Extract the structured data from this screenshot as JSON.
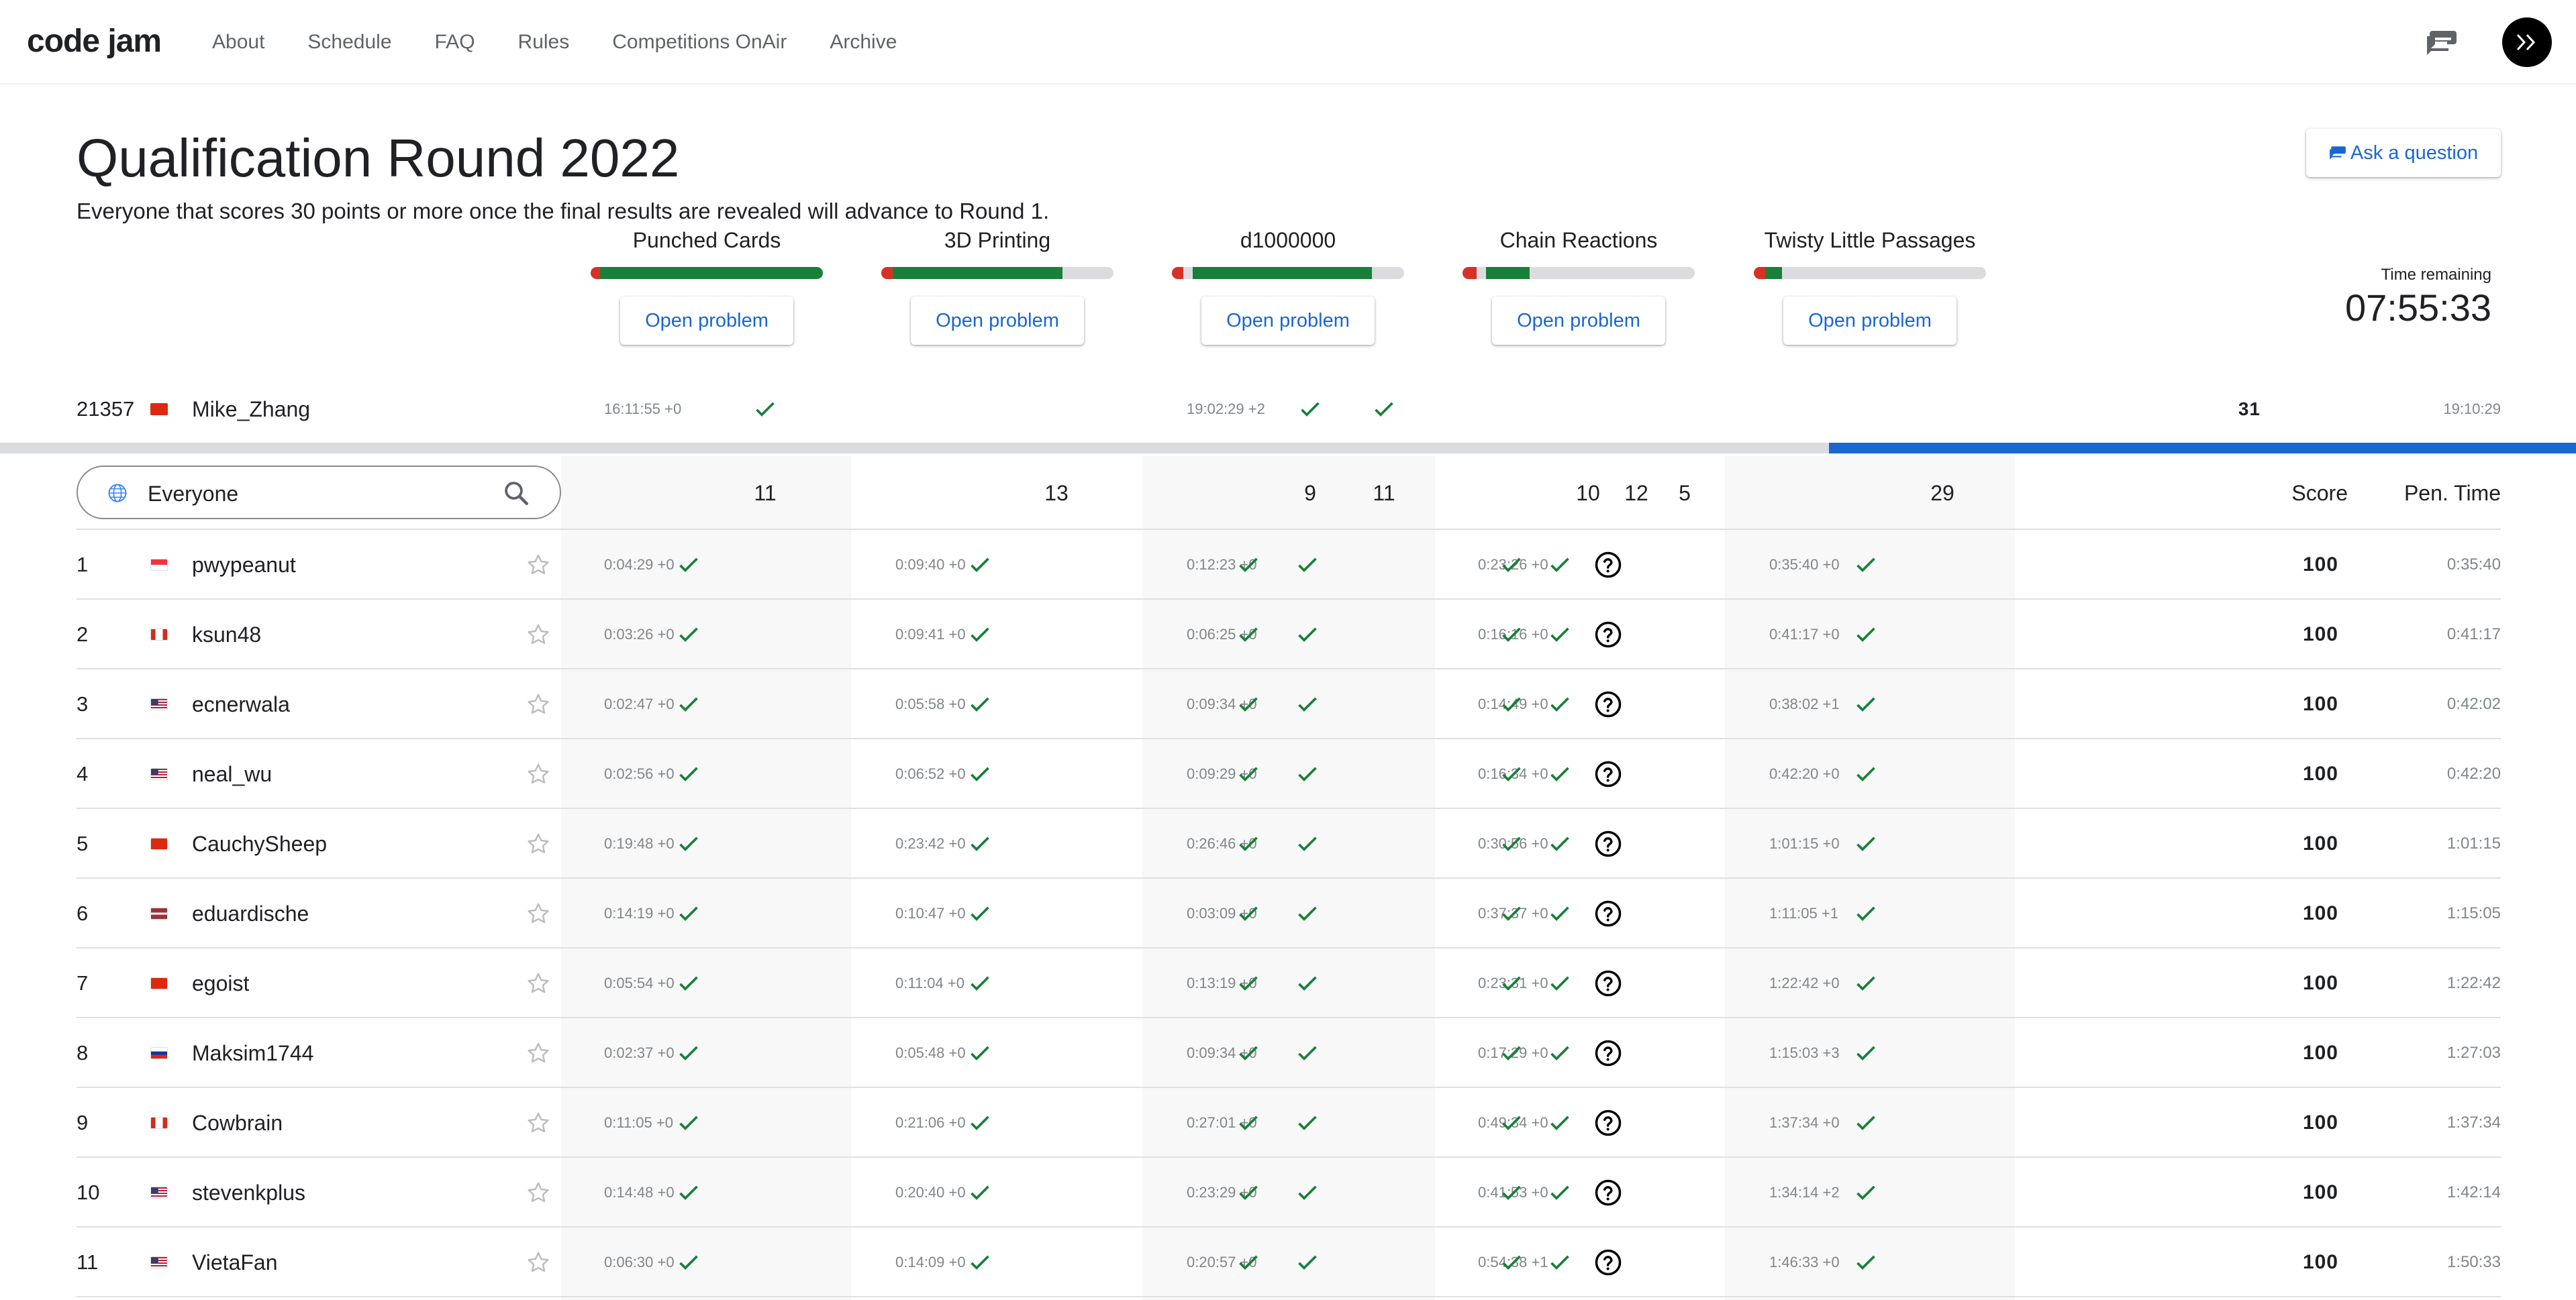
{
  "nav": {
    "brand": "code jam",
    "links": [
      "About",
      "Schedule",
      "FAQ",
      "Rules",
      "Competitions OnAir",
      "Archive"
    ]
  },
  "header": {
    "title": "Qualification Round 2022",
    "subtitle": "Everyone that scores 30 points or more once the final results are revealed will advance to Round 1.",
    "ask_label": "Ask a question",
    "time_label": "Time remaining",
    "time_value": "07:55:33"
  },
  "problems": [
    {
      "name": "Punched Cards",
      "button": "Open problem",
      "red_fraction": 0.04,
      "green_fraction": 1.0
    },
    {
      "name": "3D Printing",
      "button": "Open problem",
      "red_fraction": 0.05,
      "green_fraction": 0.78
    },
    {
      "name": "d1000000",
      "button": "Open problem",
      "red_fraction": 0.05,
      "green_fraction": 0.86,
      "gap_fraction": 0.04
    },
    {
      "name": "Chain Reactions",
      "button": "Open problem",
      "red_fraction": 0.06,
      "green_fraction": 0.29,
      "gap_fraction": 0.04
    },
    {
      "name": "Twisty Little Passages",
      "button": "Open problem",
      "red_fraction": 0.05,
      "green_fraction": 0.12
    }
  ],
  "me": {
    "rank": "21357",
    "name": "Mike_Zhang",
    "p1_time": "16:11:55 +0",
    "p3_time": "19:02:29 +2",
    "score": "31",
    "penalty": "19:10:29",
    "progress_fraction": 0.29
  },
  "filter": {
    "value": "Everyone",
    "col_points": [
      "11",
      "13",
      "9",
      "11",
      "10",
      "12",
      "5",
      "29"
    ],
    "score_label": "Score",
    "penalty_label": "Pen. Time"
  },
  "colors": {
    "accent": "#1967d2",
    "green": "#188038",
    "red": "#d93025",
    "band": "#f8f8f8"
  },
  "rows": [
    {
      "rank": "1",
      "flag": "singapore",
      "name": "pwypeanut",
      "t1": "0:04:29 +0",
      "t2": "0:09:40 +0",
      "t3": "0:12:23 +0",
      "t4": "0:23:26 +0",
      "t5": "0:35:40 +0",
      "score": "100",
      "pen": "0:35:40"
    },
    {
      "rank": "2",
      "flag": "canada",
      "name": "ksun48",
      "t1": "0:03:26 +0",
      "t2": "0:09:41 +0",
      "t3": "0:06:25 +0",
      "t4": "0:16:16 +0",
      "t5": "0:41:17 +0",
      "score": "100",
      "pen": "0:41:17"
    },
    {
      "rank": "3",
      "flag": "usa",
      "name": "ecnerwala",
      "t1": "0:02:47 +0",
      "t2": "0:05:58 +0",
      "t3": "0:09:34 +0",
      "t4": "0:14:49 +0",
      "t5": "0:38:02 +1",
      "score": "100",
      "pen": "0:42:02"
    },
    {
      "rank": "4",
      "flag": "usa",
      "name": "neal_wu",
      "t1": "0:02:56 +0",
      "t2": "0:06:52 +0",
      "t3": "0:09:29 +0",
      "t4": "0:16:34 +0",
      "t5": "0:42:20 +0",
      "score": "100",
      "pen": "0:42:20"
    },
    {
      "rank": "5",
      "flag": "china",
      "name": "CauchySheep",
      "t1": "0:19:48 +0",
      "t2": "0:23:42 +0",
      "t3": "0:26:46 +0",
      "t4": "0:30:56 +0",
      "t5": "1:01:15 +0",
      "score": "100",
      "pen": "1:01:15"
    },
    {
      "rank": "6",
      "flag": "latvia",
      "name": "eduardische",
      "t1": "0:14:19 +0",
      "t2": "0:10:47 +0",
      "t3": "0:03:09 +0",
      "t4": "0:37:37 +0",
      "t5": "1:11:05 +1",
      "score": "100",
      "pen": "1:15:05"
    },
    {
      "rank": "7",
      "flag": "china",
      "name": "egoist",
      "t1": "0:05:54 +0",
      "t2": "0:11:04 +0",
      "t3": "0:13:19 +0",
      "t4": "0:23:31 +0",
      "t5": "1:22:42 +0",
      "score": "100",
      "pen": "1:22:42"
    },
    {
      "rank": "8",
      "flag": "russia",
      "name": "Maksim1744",
      "t1": "0:02:37 +0",
      "t2": "0:05:48 +0",
      "t3": "0:09:34 +0",
      "t4": "0:17:29 +0",
      "t5": "1:15:03 +3",
      "score": "100",
      "pen": "1:27:03"
    },
    {
      "rank": "9",
      "flag": "canada",
      "name": "Cowbrain",
      "t1": "0:11:05 +0",
      "t2": "0:21:06 +0",
      "t3": "0:27:01 +0",
      "t4": "0:49:34 +0",
      "t5": "1:37:34 +0",
      "score": "100",
      "pen": "1:37:34"
    },
    {
      "rank": "10",
      "flag": "usa",
      "name": "stevenkplus",
      "t1": "0:14:48 +0",
      "t2": "0:20:40 +0",
      "t3": "0:23:29 +0",
      "t4": "0:41:53 +0",
      "t5": "1:34:14 +2",
      "score": "100",
      "pen": "1:42:14"
    },
    {
      "rank": "11",
      "flag": "usa",
      "name": "VietaFan",
      "t1": "0:06:30 +0",
      "t2": "0:14:09 +0",
      "t3": "0:20:57 +0",
      "t4": "0:54:38 +1",
      "t5": "1:46:33 +0",
      "score": "100",
      "pen": "1:50:33"
    }
  ]
}
